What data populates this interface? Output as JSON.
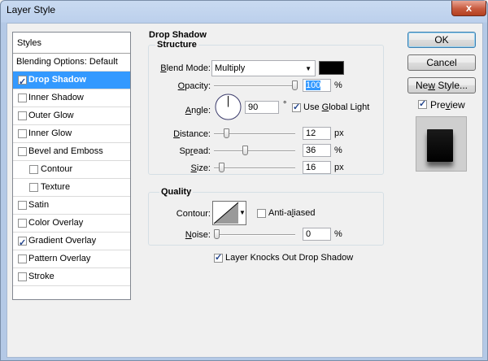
{
  "window": {
    "title": "Layer Style",
    "close_glyph": "x"
  },
  "styles_panel": {
    "header": "Styles",
    "blending": "Blending Options: Default",
    "items": [
      {
        "label": "Drop Shadow",
        "checked": true,
        "selected": true
      },
      {
        "label": "Inner Shadow",
        "checked": false
      },
      {
        "label": "Outer Glow",
        "checked": false
      },
      {
        "label": "Inner Glow",
        "checked": false
      },
      {
        "label": "Bevel and Emboss",
        "checked": false
      },
      {
        "label": "Contour",
        "checked": false,
        "indent": true
      },
      {
        "label": "Texture",
        "checked": false,
        "indent": true
      },
      {
        "label": "Satin",
        "checked": false
      },
      {
        "label": "Color Overlay",
        "checked": false
      },
      {
        "label": "Gradient Overlay",
        "checked": true
      },
      {
        "label": "Pattern Overlay",
        "checked": false
      },
      {
        "label": "Stroke",
        "checked": false
      }
    ]
  },
  "drop_shadow": {
    "title": "Drop Shadow",
    "structure": {
      "title": "Structure",
      "blend_mode": {
        "label_pre": "",
        "label_u": "B",
        "label_post": "lend Mode:",
        "value": "Multiply",
        "swatch_color": "#000000"
      },
      "opacity": {
        "label_u": "O",
        "label_post": "pacity:",
        "value": "100",
        "unit": "%",
        "level": 1.0
      },
      "angle": {
        "label_u": "A",
        "label_post": "ngle:",
        "value": "90",
        "unit": "°",
        "global_light_u": "G",
        "global_light_pre": "Use ",
        "global_light_post": "lobal Light",
        "global_light_checked": true
      },
      "distance": {
        "label_u": "D",
        "label_post": "istance:",
        "value": "12",
        "unit": "px",
        "level": 0.12
      },
      "spread": {
        "label_pre": "Sp",
        "label_u": "r",
        "label_post": "ead:",
        "value": "36",
        "unit": "%",
        "level": 0.36
      },
      "size": {
        "label_u": "S",
        "label_post": "ize:",
        "value": "16",
        "unit": "px",
        "level": 0.064
      }
    },
    "quality": {
      "title": "Quality",
      "contour_label": "Contour:",
      "anti_aliased": {
        "label_pre": "Anti-a",
        "label_u": "l",
        "label_post": "iased",
        "checked": false
      },
      "noise": {
        "label_u": "N",
        "label_post": "oise:",
        "value": "0",
        "unit": "%",
        "level": 0.0
      }
    },
    "knockout": {
      "label": "Layer Knocks Out Drop Shadow",
      "checked": true
    }
  },
  "buttons": {
    "ok": "OK",
    "cancel": "Cancel",
    "new_style_pre": "Ne",
    "new_style_u": "w",
    "new_style_post": " Style...",
    "preview_pre": "Pre",
    "preview_u": "v",
    "preview_post": "iew",
    "preview_checked": true
  },
  "colors": {
    "selection": "#3399ff",
    "title_bar": "#bcd0ec",
    "close_button": "#c75a3e"
  }
}
